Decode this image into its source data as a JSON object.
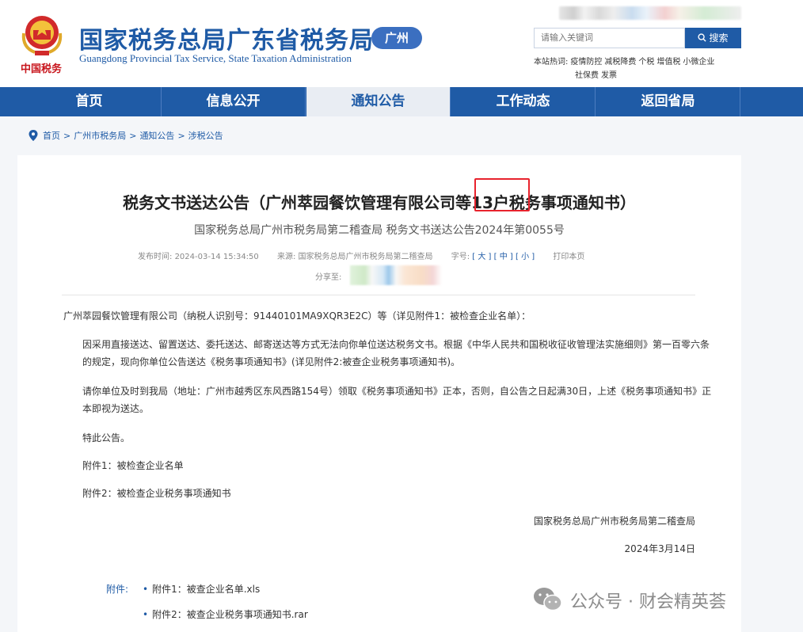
{
  "header": {
    "brand_sub": "中国税务",
    "site_title": "国家税务总局广东省税务局",
    "site_title_en": "Guangdong Provincial Tax Service, State Taxation Administration",
    "city_badge": "广州",
    "search_placeholder": "请输入关键词",
    "search_button": "搜索",
    "hot_label": "本站热词:",
    "hot_words": [
      "疫情防控",
      "减税降费",
      "个税",
      "增值税",
      "小微企业",
      "社保费",
      "发票"
    ]
  },
  "nav": {
    "items": [
      "首页",
      "信息公开",
      "通知公告",
      "工作动态",
      "返回省局"
    ],
    "active_index": 2
  },
  "breadcrumb": [
    "首页",
    "广州市税务局",
    "通知公告",
    "涉税公告"
  ],
  "article": {
    "title": "税务文书送达公告（广州萃园餐饮管理有限公司等13户税务事项通知书）",
    "subtitle": "国家税务总局广州市税务局第二稽查局 税务文书送达公告2024年第0055号",
    "meta": {
      "publish_label": "发布时间:",
      "publish_time": "2024-03-14 15:34:50",
      "source_label": "来源:",
      "source": "国家税务总局广州市税务局第二稽查局",
      "font_label": "字号:",
      "font_large": "[ 大 ]",
      "font_mid": "[ 中 ]",
      "font_small": "[ 小 ]",
      "print": "打印本页",
      "share_label": "分享至:"
    },
    "paragraphs": [
      "广州萃园餐饮管理有限公司（纳税人识别号：91440101MA9XQR3E2C）等（详见附件1：被检查企业名单）：",
      "因采用直接送达、留置送达、委托送达、邮寄送达等方式无法向你单位送达税务文书。根据《中华人民共和国税收征收管理法实施细则》第一百零六条的规定，现向你单位公告送达《税务事项通知书》(详见附件2:被查企业税务事项通知书)。",
      "请你单位及时到我局（地址：广州市越秀区东风西路154号）领取《税务事项通知书》正本，否则，自公告之日起满30日，上述《税务事项通知书》正本即视为送达。",
      "特此公告。",
      "附件1：被检查企业名单",
      "附件2：被检查企业税务事项通知书"
    ],
    "signature": "国家税务总局广州市税务局第二稽查局",
    "date": "2024年3月14日",
    "attachments_label": "附件:",
    "attachments": [
      "附件1：被查企业名单.xls",
      "附件2：被查企业税务事项通知书.rar"
    ]
  },
  "watermark": {
    "text": "公众号 · 财会精英荟"
  },
  "colors": {
    "brand_blue": "#1f5ba6",
    "highlight_red": "#e8232d"
  }
}
